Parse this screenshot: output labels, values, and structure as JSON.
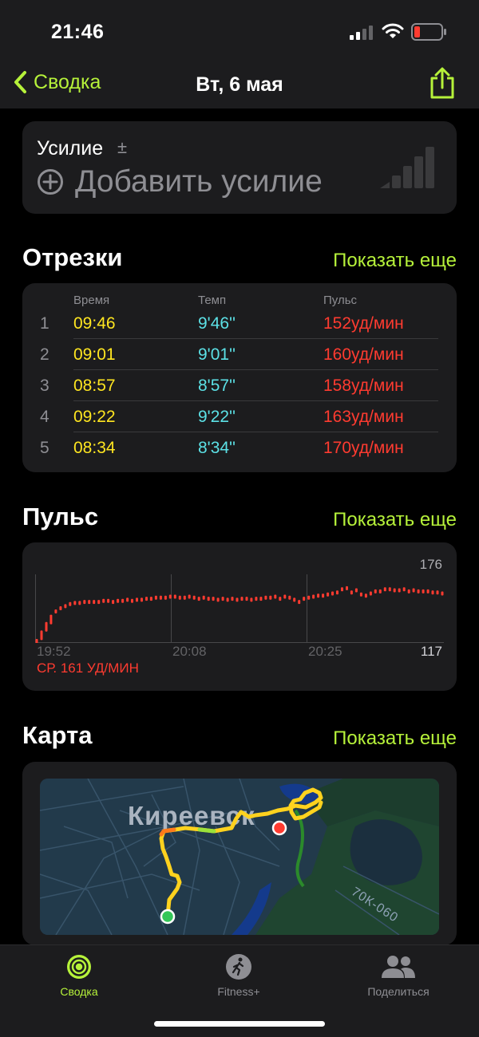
{
  "status": {
    "time": "21:46"
  },
  "nav": {
    "back_label": "Сводка",
    "title": "Вт, 6 мая"
  },
  "effort": {
    "label": "Усилие",
    "plusminus": "±",
    "add_label": "Добавить усилие"
  },
  "splits": {
    "title": "Отрезки",
    "show_more": "Показать еще",
    "columns": {
      "time": "Время",
      "pace": "Темп",
      "hr": "Пульс"
    },
    "rows": [
      {
        "num": "1",
        "time": "09:46",
        "pace": "9'46''",
        "hr": "152уд/мин"
      },
      {
        "num": "2",
        "time": "09:01",
        "pace": "9'01''",
        "hr": "160уд/мин"
      },
      {
        "num": "3",
        "time": "08:57",
        "pace": "8'57''",
        "hr": "158уд/мин"
      },
      {
        "num": "4",
        "time": "09:22",
        "pace": "9'22''",
        "hr": "163уд/мин"
      },
      {
        "num": "5",
        "time": "08:34",
        "pace": "8'34''",
        "hr": "170уд/мин"
      }
    ]
  },
  "pulse": {
    "title": "Пульс",
    "show_more": "Показать еще",
    "max_label": "176",
    "min_label": "117",
    "x_labels": [
      "19:52",
      "20:08",
      "20:25"
    ],
    "avg_label": "СР. 161 УД/МИН"
  },
  "map": {
    "title": "Карта",
    "show_more": "Показать еще",
    "city_label": "Киреевск",
    "road_label": "70К-060"
  },
  "tabs": [
    {
      "label": "Сводка",
      "active": true
    },
    {
      "label": "Fitness+",
      "active": false
    },
    {
      "label": "Поделиться",
      "active": false
    }
  ],
  "colors": {
    "accent": "#b6f23a",
    "time": "#ffe620",
    "pace": "#5ce1e6",
    "heart_rate": "#ff3b30"
  },
  "chart_data": {
    "type": "line",
    "series": [
      {
        "values": [
          117,
          125,
          133,
          140,
          145,
          148,
          150,
          152,
          153,
          153,
          154,
          154,
          154,
          154,
          155,
          155,
          154,
          155,
          155,
          156,
          155,
          156,
          156,
          157,
          157,
          158,
          158,
          158,
          159,
          159,
          158,
          158,
          159,
          158,
          157,
          158,
          157,
          157,
          156,
          157,
          156,
          157,
          156,
          157,
          157,
          156,
          157,
          157,
          158,
          158,
          159,
          157,
          159,
          158,
          156,
          154,
          157,
          158,
          159,
          160,
          160,
          161,
          162,
          163,
          166,
          167,
          163,
          165,
          161,
          160,
          162,
          164,
          164,
          166,
          166,
          165,
          165,
          166,
          164,
          165,
          164,
          164,
          164,
          163,
          163,
          162
        ]
      }
    ],
    "ylim": [
      117,
      176
    ],
    "x_tick_labels": [
      "19:52",
      "20:08",
      "20:25"
    ],
    "grid": true
  }
}
